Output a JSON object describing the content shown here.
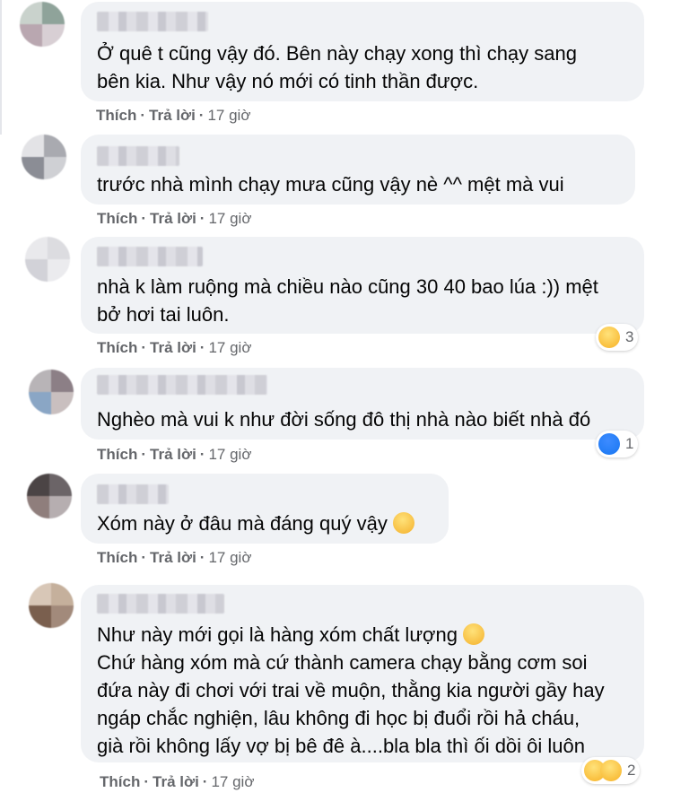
{
  "comments": [
    {
      "text": "Ở quê t cũng vậy đó. Bên này chạy xong thì chạy sang\nbên kia. Như vậy nó mới có tinh thần được.",
      "like_label": "Thích",
      "reply_label": "Trả lời",
      "time": "17 giờ"
    },
    {
      "text": "trước nhà mình chạy mưa cũng vậy nè ^^ mệt mà vui",
      "like_label": "Thích",
      "reply_label": "Trả lời",
      "time": "17 giờ"
    },
    {
      "text": "nhà k làm ruộng mà chiều nào cũng 30 40 bao lúa :)) mệt\nbở hơi tai luôn.",
      "like_label": "Thích",
      "reply_label": "Trả lời",
      "time": "17 giờ",
      "reaction": {
        "icons": [
          "haha"
        ],
        "count": "3"
      }
    },
    {
      "text": "Nghèo mà vui k như đời sống đô thị nhà nào biết nhà đó",
      "like_label": "Thích",
      "reply_label": "Trả lời",
      "time": "17 giờ",
      "reaction": {
        "icons": [
          "like"
        ],
        "count": "1"
      }
    },
    {
      "text": "Xóm này ở đâu mà đáng quý vậy",
      "like_label": "Thích",
      "reply_label": "Trả lời",
      "time": "17 giờ"
    },
    {
      "line1": "Như này mới gọi là hàng xóm chất lượng",
      "text": "Chứ hàng xóm mà cứ thành camera chạy bằng cơm soi\nđứa này đi chơi với trai về muộn, thằng kia người gầy hay\nngáp chắc nghiện, lâu không đi học bị đuổi rồi hả cháu,\ngià rồi không lấy vợ bị bê đê à....bla bla thì ối dồi ôi luôn",
      "like_label": "Thích",
      "reply_label": "Trả lời",
      "time": "17 giờ",
      "reaction": {
        "icons": [
          "haha",
          "sad"
        ],
        "count": "2"
      }
    }
  ],
  "separator": "·",
  "colors": {
    "bubble": "#f0f2f5",
    "meta": "#65676b",
    "text": "#050505",
    "like_blue": "#1877f2",
    "haha_yellow": "#f7b125"
  }
}
